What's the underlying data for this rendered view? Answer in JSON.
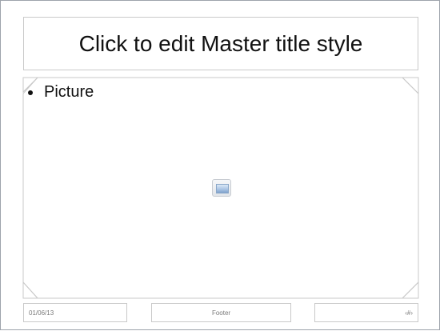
{
  "slide": {
    "title": "Click to edit Master title style",
    "content": {
      "bullet": "Picture",
      "icon": "picture-placeholder-icon"
    },
    "footer": {
      "date": "01/06/13",
      "text": "Footer",
      "slide_number": "‹#›"
    }
  }
}
